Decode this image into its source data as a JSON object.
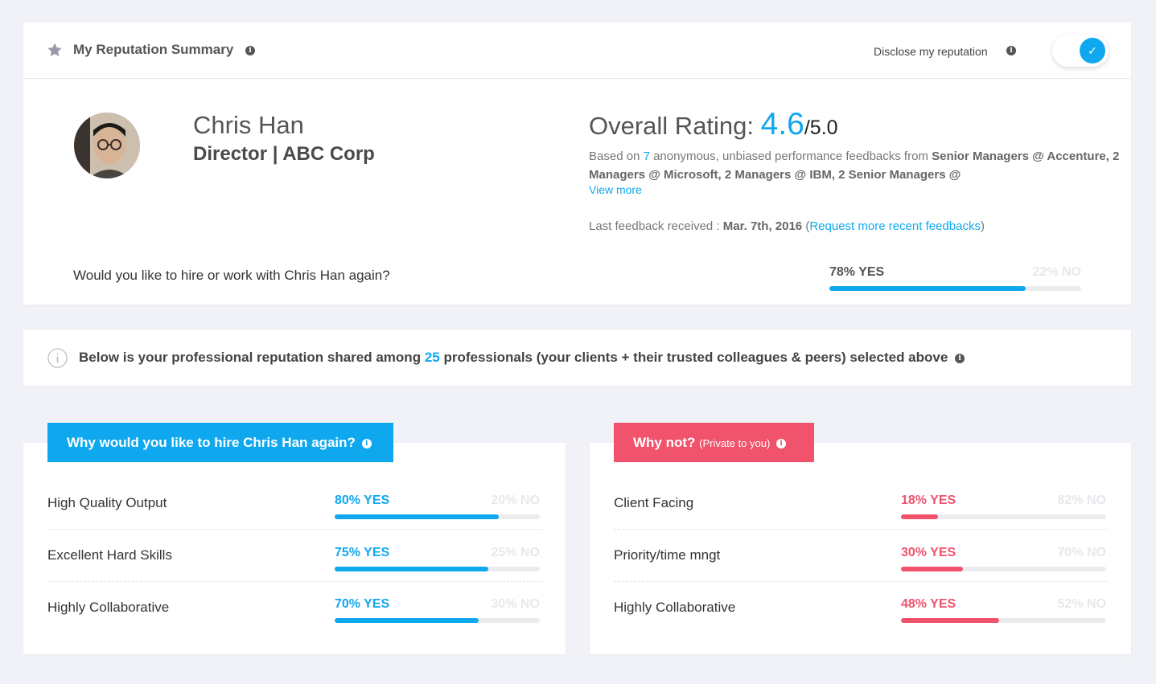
{
  "header": {
    "title": "My Reputation Summary",
    "disclose_label": "Disclose my reputation",
    "disclose_enabled": true
  },
  "profile": {
    "name": "Chris Han",
    "role": "Director | ABC Corp"
  },
  "rating": {
    "label": "Overall Rating: ",
    "value": "4.6",
    "max": "/5.0",
    "based_on_prefix": "Based on ",
    "feedback_count": "7",
    "based_on_middle": " anonymous, unbiased performance feedbacks from ",
    "based_on_sources": "Senior Managers @ Accenture, 2 Managers @ Microsoft, 2 Managers @ IBM, 2 Senior Managers @",
    "view_more": "View more",
    "last_feedback_label": "Last feedback received : ",
    "last_feedback_date": "Mar. 7th, 2016",
    "request_link": "Request more recent feedbacks",
    "open_paren": "(",
    "close_paren": ")"
  },
  "hire_again": {
    "question": "Would you like to hire or work with Chris Han again?",
    "yes_label": "78% YES",
    "no_label": "22% NO",
    "yes_fraction": 0.78
  },
  "banner": {
    "text_prefix": "Below is your professional reputation shared among ",
    "count": "25",
    "text_suffix": " professionals (your clients + their trusted colleagues & peers) selected above"
  },
  "why": {
    "title": "Why would you like to hire Chris Han again?",
    "items": [
      {
        "label": "High Quality Output",
        "yes_label": "80% YES",
        "no_label": "20% NO",
        "yes_fraction": 0.8
      },
      {
        "label": "Excellent Hard Skills",
        "yes_label": "75% YES",
        "no_label": "25% NO",
        "yes_fraction": 0.75
      },
      {
        "label": "Highly Collaborative",
        "yes_label": "70% YES",
        "no_label": "30% NO",
        "yes_fraction": 0.7
      }
    ]
  },
  "why_not": {
    "title": "Why not?",
    "subtitle": "(Private to you)",
    "items": [
      {
        "label": "Client Facing",
        "yes_label": "18% YES",
        "no_label": "82% NO",
        "yes_fraction": 0.18
      },
      {
        "label": "Priority/time mngt",
        "yes_label": "30% YES",
        "no_label": "70% NO",
        "yes_fraction": 0.3
      },
      {
        "label": "Highly Collaborative",
        "yes_label": "48% YES",
        "no_label": "52% NO",
        "yes_fraction": 0.48
      }
    ]
  },
  "icons": {
    "star": "star-icon",
    "info": "info-icon",
    "check": "check-icon"
  },
  "colors": {
    "accent_blue": "#0fa8ef",
    "accent_red": "#f0536b"
  }
}
